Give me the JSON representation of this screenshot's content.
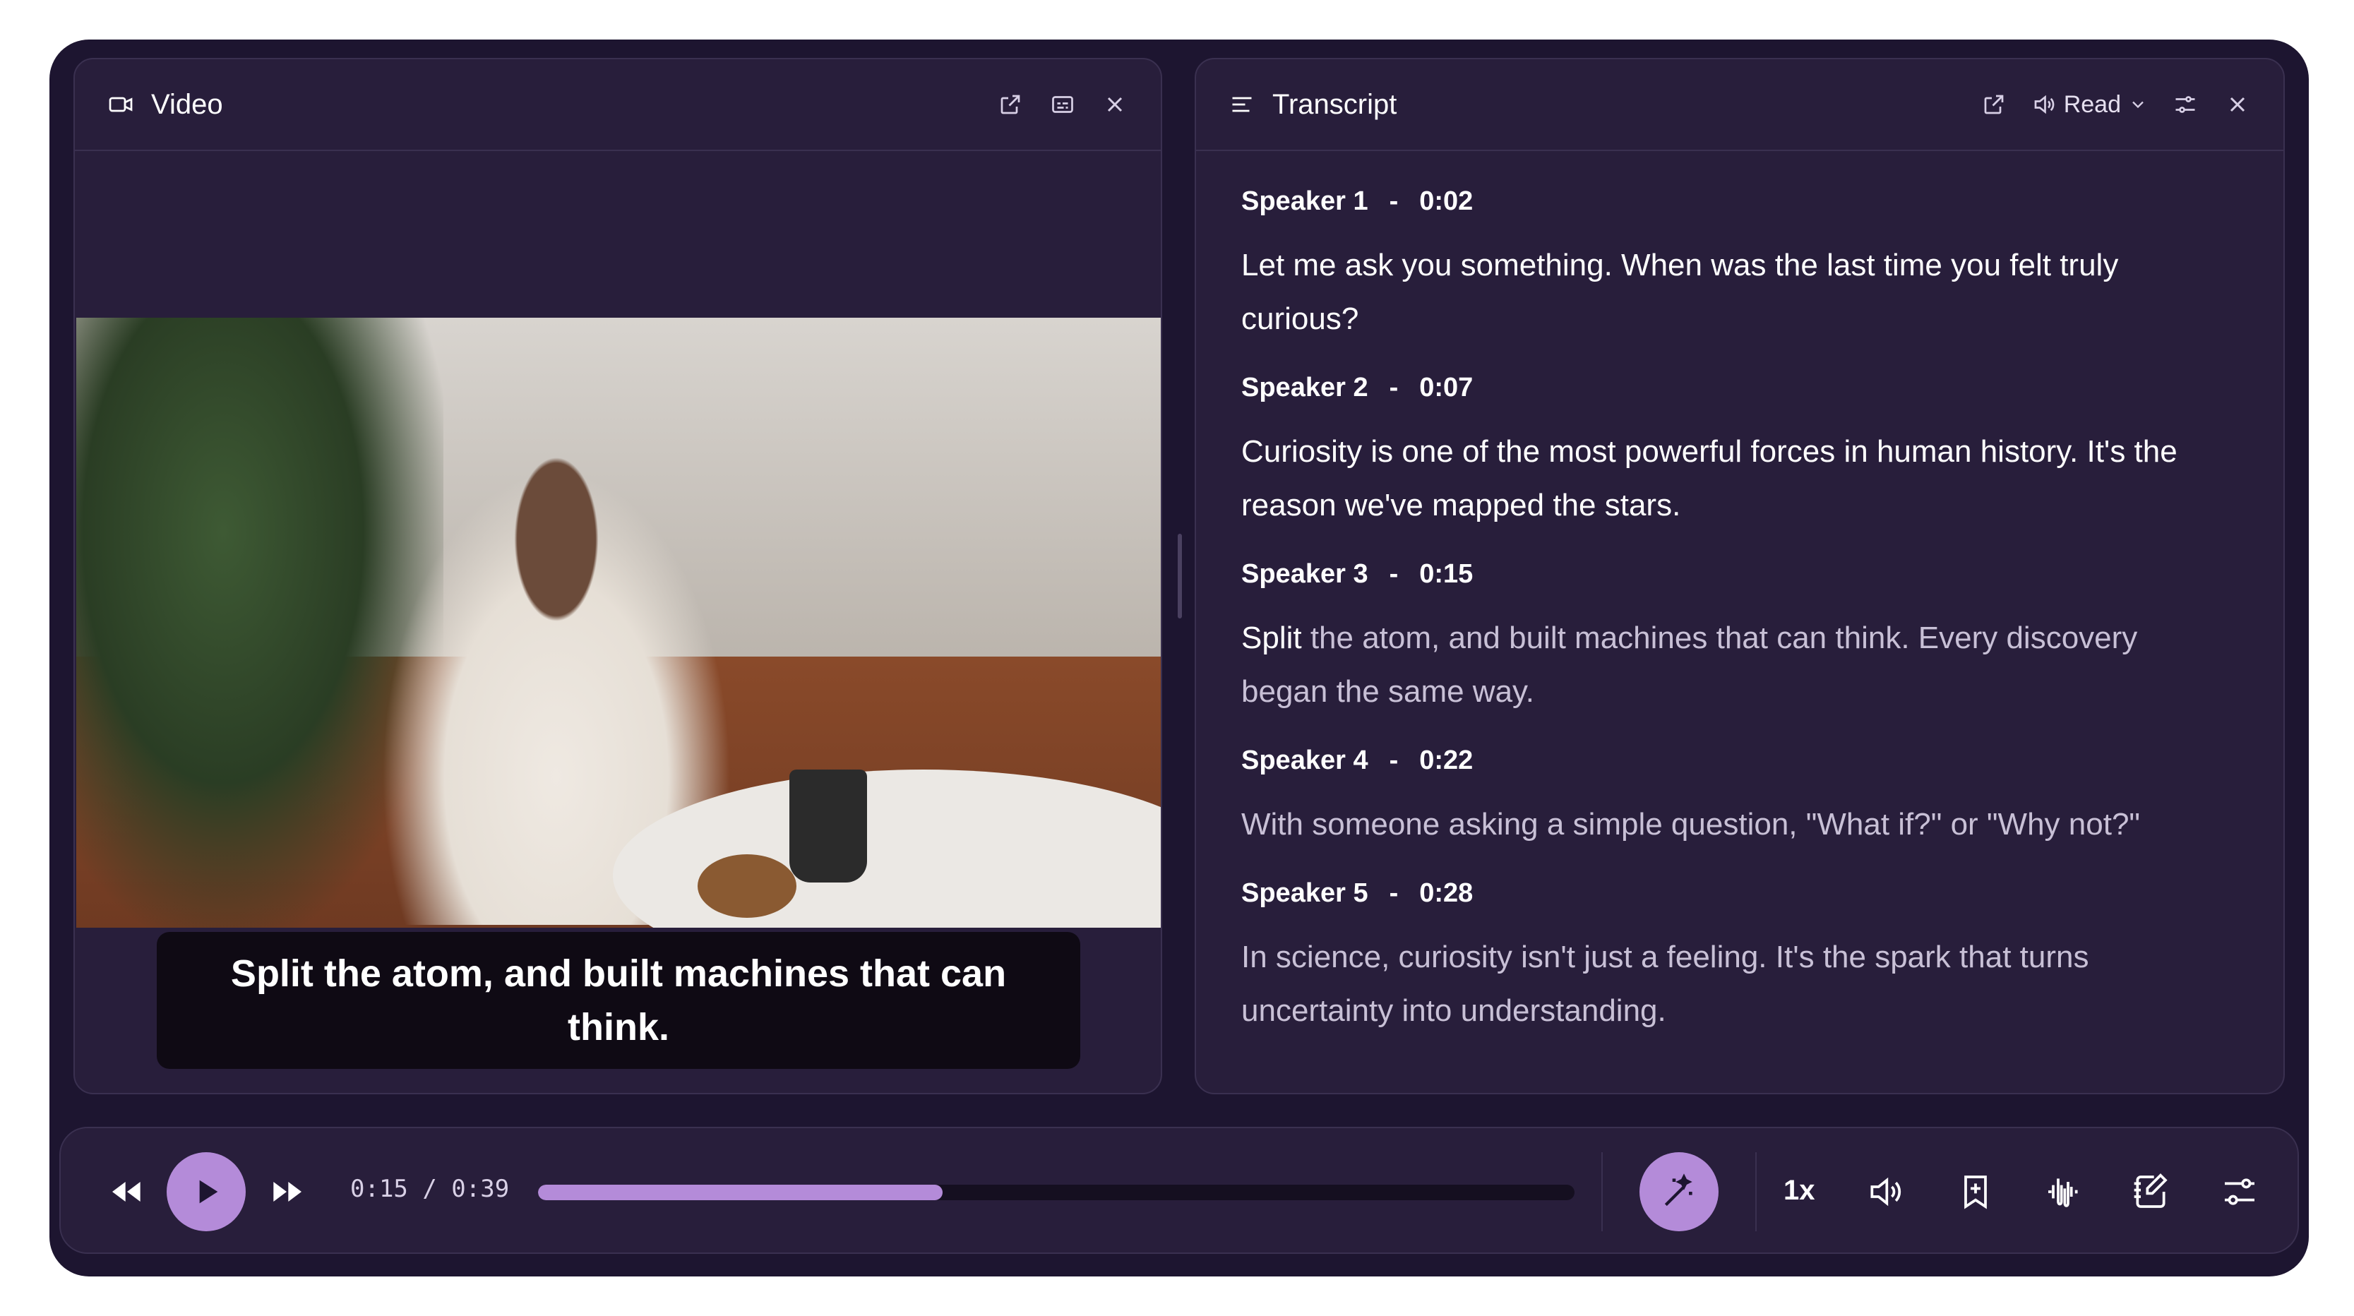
{
  "video_panel": {
    "title": "Video",
    "icons": [
      "video-camera-icon",
      "open-external-icon",
      "captions-icon",
      "close-icon"
    ],
    "caption": "Split the atom, and built machines that can think."
  },
  "transcript_panel": {
    "title": "Transcript",
    "read_label": "Read",
    "icons": [
      "menu-lines-icon",
      "open-external-icon",
      "speaker-icon",
      "chevron-down-icon",
      "sliders-icon",
      "close-icon"
    ],
    "entries": [
      {
        "speaker": "Speaker 1",
        "separator": "-",
        "time": "0:02",
        "text": "Let me ask you something. When was the last time you felt truly curious?"
      },
      {
        "speaker": "Speaker 2",
        "separator": "-",
        "time": "0:07",
        "text": "Curiosity is one of the most powerful forces in human history. It's the reason we've mapped the stars."
      },
      {
        "speaker": "Speaker 3",
        "separator": "-",
        "time": "0:15",
        "text_highlight": "Split",
        "text": " the atom, and built machines that can think. Every discovery began the same way."
      },
      {
        "speaker": "Speaker 4",
        "separator": "-",
        "time": "0:22",
        "text": "With someone asking a simple question, \"What if?\" or \"Why not?\""
      },
      {
        "speaker": "Speaker 5",
        "separator": "-",
        "time": "0:28",
        "text": "In science, curiosity isn't just a feeling. It's the spark that turns uncertainty into understanding."
      }
    ]
  },
  "player": {
    "time_display": "0:15 / 0:39",
    "progress": 0.39,
    "speed": "1x",
    "accent_color": "#b48bd9",
    "icons": [
      "rewind-icon",
      "play-icon",
      "fast-forward-icon",
      "magic-wand-icon",
      "volume-icon",
      "bookmark-add-icon",
      "waveform-icon",
      "notes-edit-icon",
      "settings-sliders-icon"
    ]
  }
}
